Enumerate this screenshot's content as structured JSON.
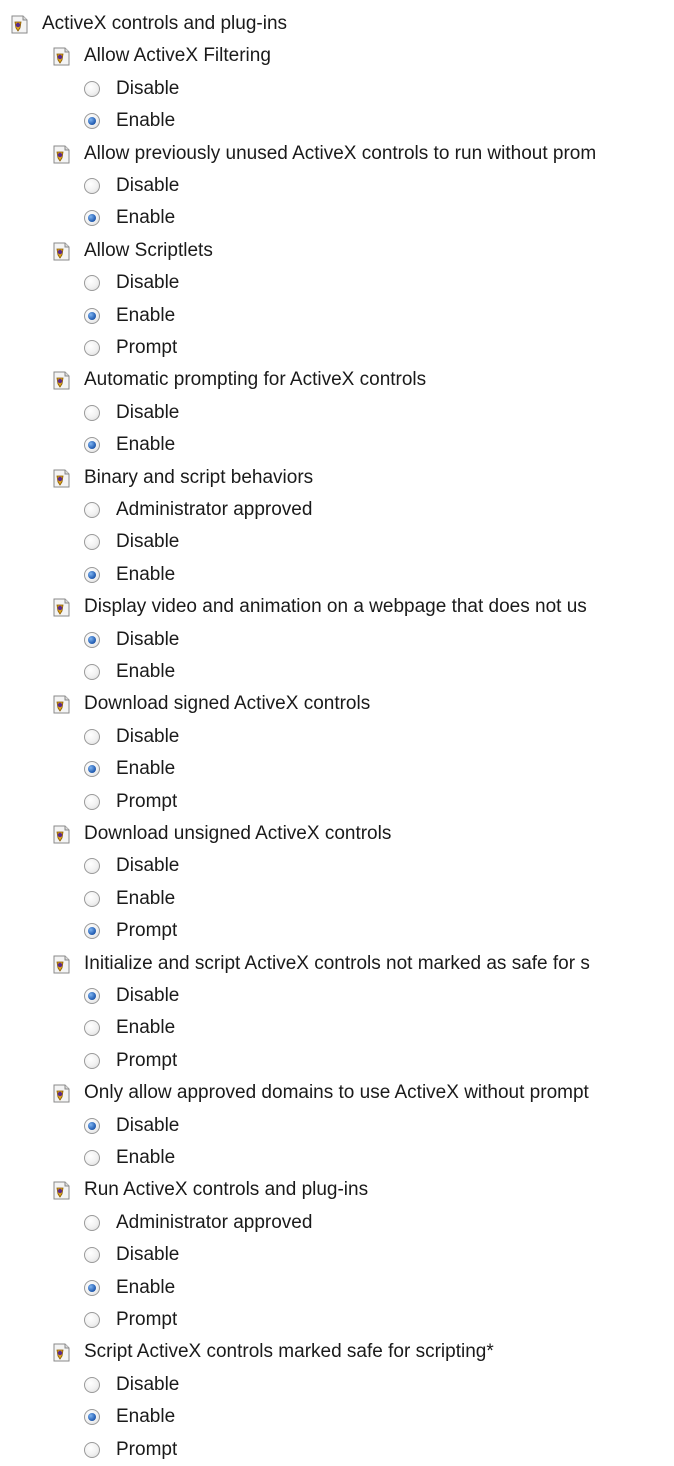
{
  "root_label": "ActiveX controls and plug-ins",
  "settings": [
    {
      "label": "Allow ActiveX Filtering",
      "options": [
        {
          "label": "Disable",
          "checked": false
        },
        {
          "label": "Enable",
          "checked": true
        }
      ]
    },
    {
      "label": "Allow previously unused ActiveX controls to run without prom",
      "options": [
        {
          "label": "Disable",
          "checked": false
        },
        {
          "label": "Enable",
          "checked": true
        }
      ]
    },
    {
      "label": "Allow Scriptlets",
      "options": [
        {
          "label": "Disable",
          "checked": false
        },
        {
          "label": "Enable",
          "checked": true
        },
        {
          "label": "Prompt",
          "checked": false
        }
      ]
    },
    {
      "label": "Automatic prompting for ActiveX controls",
      "options": [
        {
          "label": "Disable",
          "checked": false
        },
        {
          "label": "Enable",
          "checked": true
        }
      ]
    },
    {
      "label": "Binary and script behaviors",
      "options": [
        {
          "label": "Administrator approved",
          "checked": false
        },
        {
          "label": "Disable",
          "checked": false
        },
        {
          "label": "Enable",
          "checked": true
        }
      ]
    },
    {
      "label": "Display video and animation on a webpage that does not us",
      "options": [
        {
          "label": "Disable",
          "checked": true
        },
        {
          "label": "Enable",
          "checked": false
        }
      ]
    },
    {
      "label": "Download signed ActiveX controls",
      "options": [
        {
          "label": "Disable",
          "checked": false
        },
        {
          "label": "Enable",
          "checked": true
        },
        {
          "label": "Prompt",
          "checked": false
        }
      ]
    },
    {
      "label": "Download unsigned ActiveX controls",
      "options": [
        {
          "label": "Disable",
          "checked": false
        },
        {
          "label": "Enable",
          "checked": false
        },
        {
          "label": "Prompt",
          "checked": true
        }
      ]
    },
    {
      "label": "Initialize and script ActiveX controls not marked as safe for s",
      "options": [
        {
          "label": "Disable",
          "checked": true
        },
        {
          "label": "Enable",
          "checked": false
        },
        {
          "label": "Prompt",
          "checked": false
        }
      ]
    },
    {
      "label": "Only allow approved domains to use ActiveX without prompt",
      "options": [
        {
          "label": "Disable",
          "checked": true
        },
        {
          "label": "Enable",
          "checked": false
        }
      ]
    },
    {
      "label": "Run ActiveX controls and plug-ins",
      "options": [
        {
          "label": "Administrator approved",
          "checked": false
        },
        {
          "label": "Disable",
          "checked": false
        },
        {
          "label": "Enable",
          "checked": true
        },
        {
          "label": "Prompt",
          "checked": false
        }
      ]
    },
    {
      "label": "Script ActiveX controls marked safe for scripting*",
      "options": [
        {
          "label": "Disable",
          "checked": false
        },
        {
          "label": "Enable",
          "checked": true
        },
        {
          "label": "Prompt",
          "checked": false
        }
      ]
    }
  ],
  "icons": {
    "setting": "settings-page-icon",
    "option": "radio-button-icon"
  },
  "colors": {
    "radio_dot": "#2a64b8",
    "text": "#1a1a1a"
  }
}
